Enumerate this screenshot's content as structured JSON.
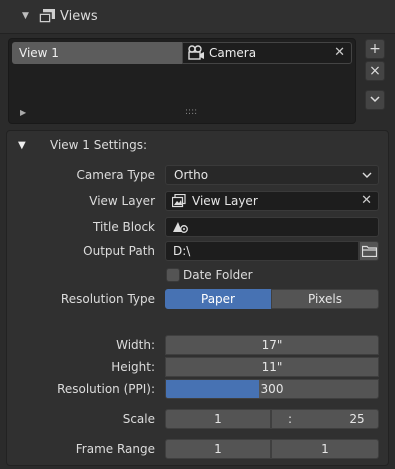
{
  "header": {
    "title": "Views"
  },
  "list": {
    "view_name": "View 1",
    "camera_name": "Camera",
    "grip": "::::"
  },
  "side_buttons": {
    "add": "+",
    "remove": "×",
    "more": "⌄"
  },
  "settings": {
    "title": "View 1 Settings:",
    "camera_type": {
      "label": "Camera Type",
      "value": "Ortho"
    },
    "view_layer": {
      "label": "View Layer",
      "value": "View Layer"
    },
    "title_block": {
      "label": "Title Block",
      "value": ""
    },
    "output_path": {
      "label": "Output Path",
      "value": "D:\\"
    },
    "date_folder": {
      "label": "Date Folder",
      "checked": false
    },
    "resolution_type": {
      "label": "Resolution Type",
      "options": [
        "Paper",
        "Pixels"
      ],
      "selected": "Paper"
    },
    "width": {
      "label": "Width:",
      "value": "17\""
    },
    "height": {
      "label": "Height:",
      "value": "11\""
    },
    "resolution": {
      "label": "Resolution (PPI):",
      "value": "300",
      "fill": 0.44
    },
    "scale": {
      "label": "Scale",
      "left": "1",
      "sep": ":",
      "right": "25"
    },
    "frame_range": {
      "label": "Frame Range",
      "start": "1",
      "end": "1"
    }
  },
  "colors": {
    "accent": "#4772b3",
    "panel": "#303030",
    "field": "#1d1d1d"
  }
}
